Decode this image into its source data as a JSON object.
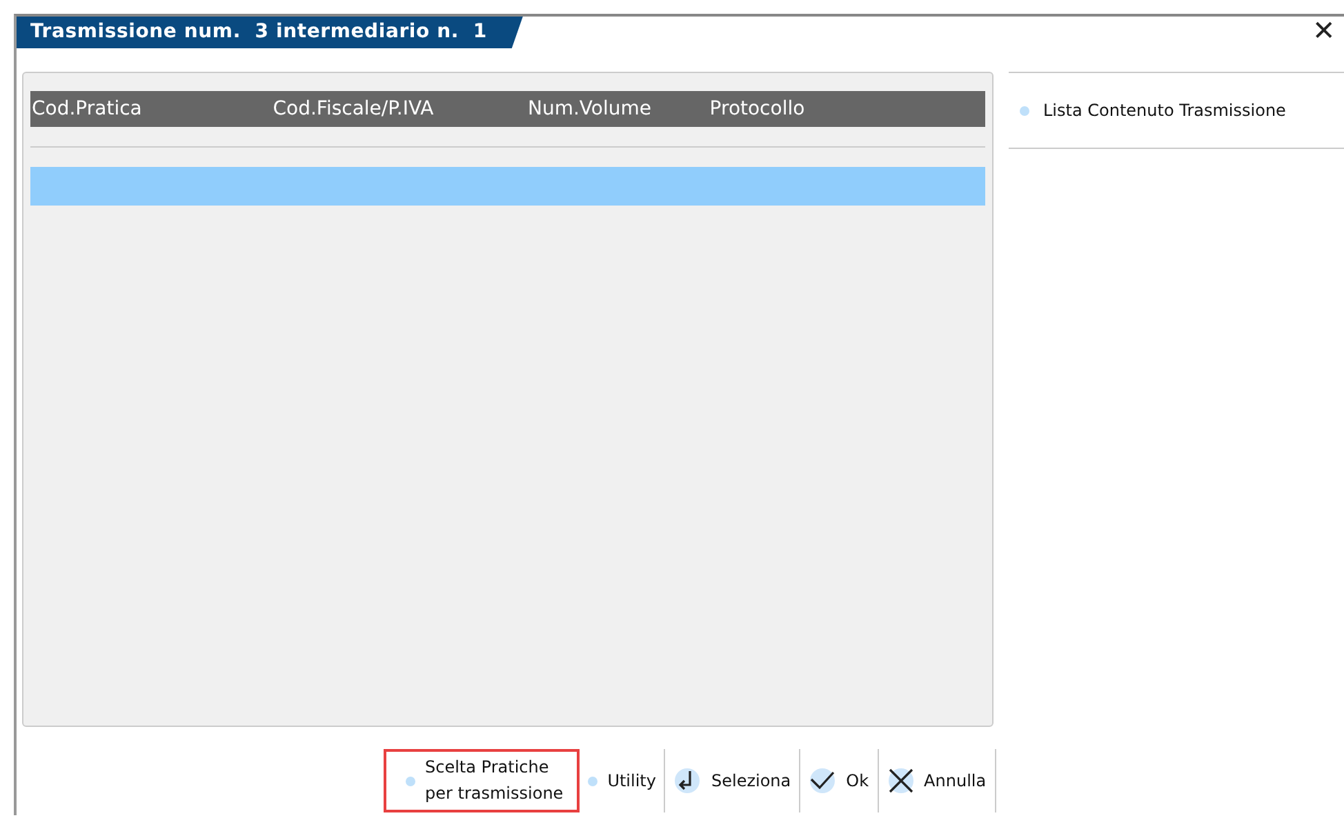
{
  "window": {
    "title": "Trasmissione num.  3 intermediario n.  1",
    "close": "✕"
  },
  "table": {
    "columns": [
      "Cod.Pratica",
      "Cod.Fiscale/P.IVA",
      "Num.Volume",
      "Protocollo"
    ],
    "rows": [
      {
        "selected": true
      }
    ]
  },
  "side_menu": [
    {
      "label": "Lista Contenuto Trasmissione"
    }
  ],
  "buttons": [
    {
      "kind": "dot",
      "label": "Scelta Pratiche\nper trasmissione",
      "highlighted": true
    },
    {
      "kind": "dot",
      "label": "Utility",
      "highlighted": false
    },
    {
      "kind": "enter",
      "label": "Seleziona",
      "highlighted": false
    },
    {
      "kind": "check",
      "label": "Ok",
      "highlighted": false
    },
    {
      "kind": "cross",
      "label": "Annulla",
      "highlighted": false
    }
  ]
}
